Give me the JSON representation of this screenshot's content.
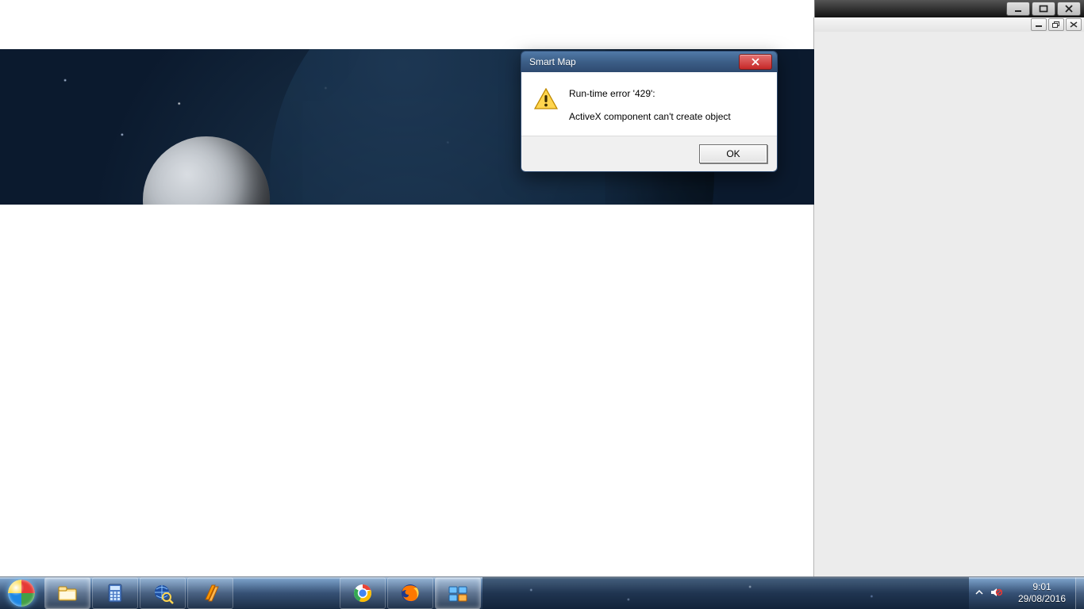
{
  "bgwindow": {
    "caption_buttons": {
      "minimize": "minimize",
      "maximize": "maximize",
      "close": "close"
    },
    "mdi_buttons": {
      "minimize": "minimize",
      "restore": "restore",
      "close": "close"
    }
  },
  "dialog": {
    "title": "Smart Map",
    "line1": "Run-time error '429':",
    "line2": "ActiveX component can't create object",
    "ok_label": "OK",
    "icon": "warning-icon",
    "close_icon": "close-icon"
  },
  "taskbar": {
    "start": "start-orb",
    "buttons_left": [
      {
        "name": "file-explorer-icon"
      },
      {
        "name": "calculator-icon"
      },
      {
        "name": "globe-search-icon"
      },
      {
        "name": "winamp-icon"
      }
    ],
    "buttons_center": [
      {
        "name": "chrome-icon"
      },
      {
        "name": "firefox-icon"
      },
      {
        "name": "task-switcher-icon",
        "active": true
      }
    ],
    "tray": {
      "show_hidden": "show-hidden-icons",
      "volume": "volume-icon-muted"
    },
    "clock": {
      "time": "9:01",
      "date": "29/08/2016"
    },
    "show_desktop": "show-desktop"
  }
}
